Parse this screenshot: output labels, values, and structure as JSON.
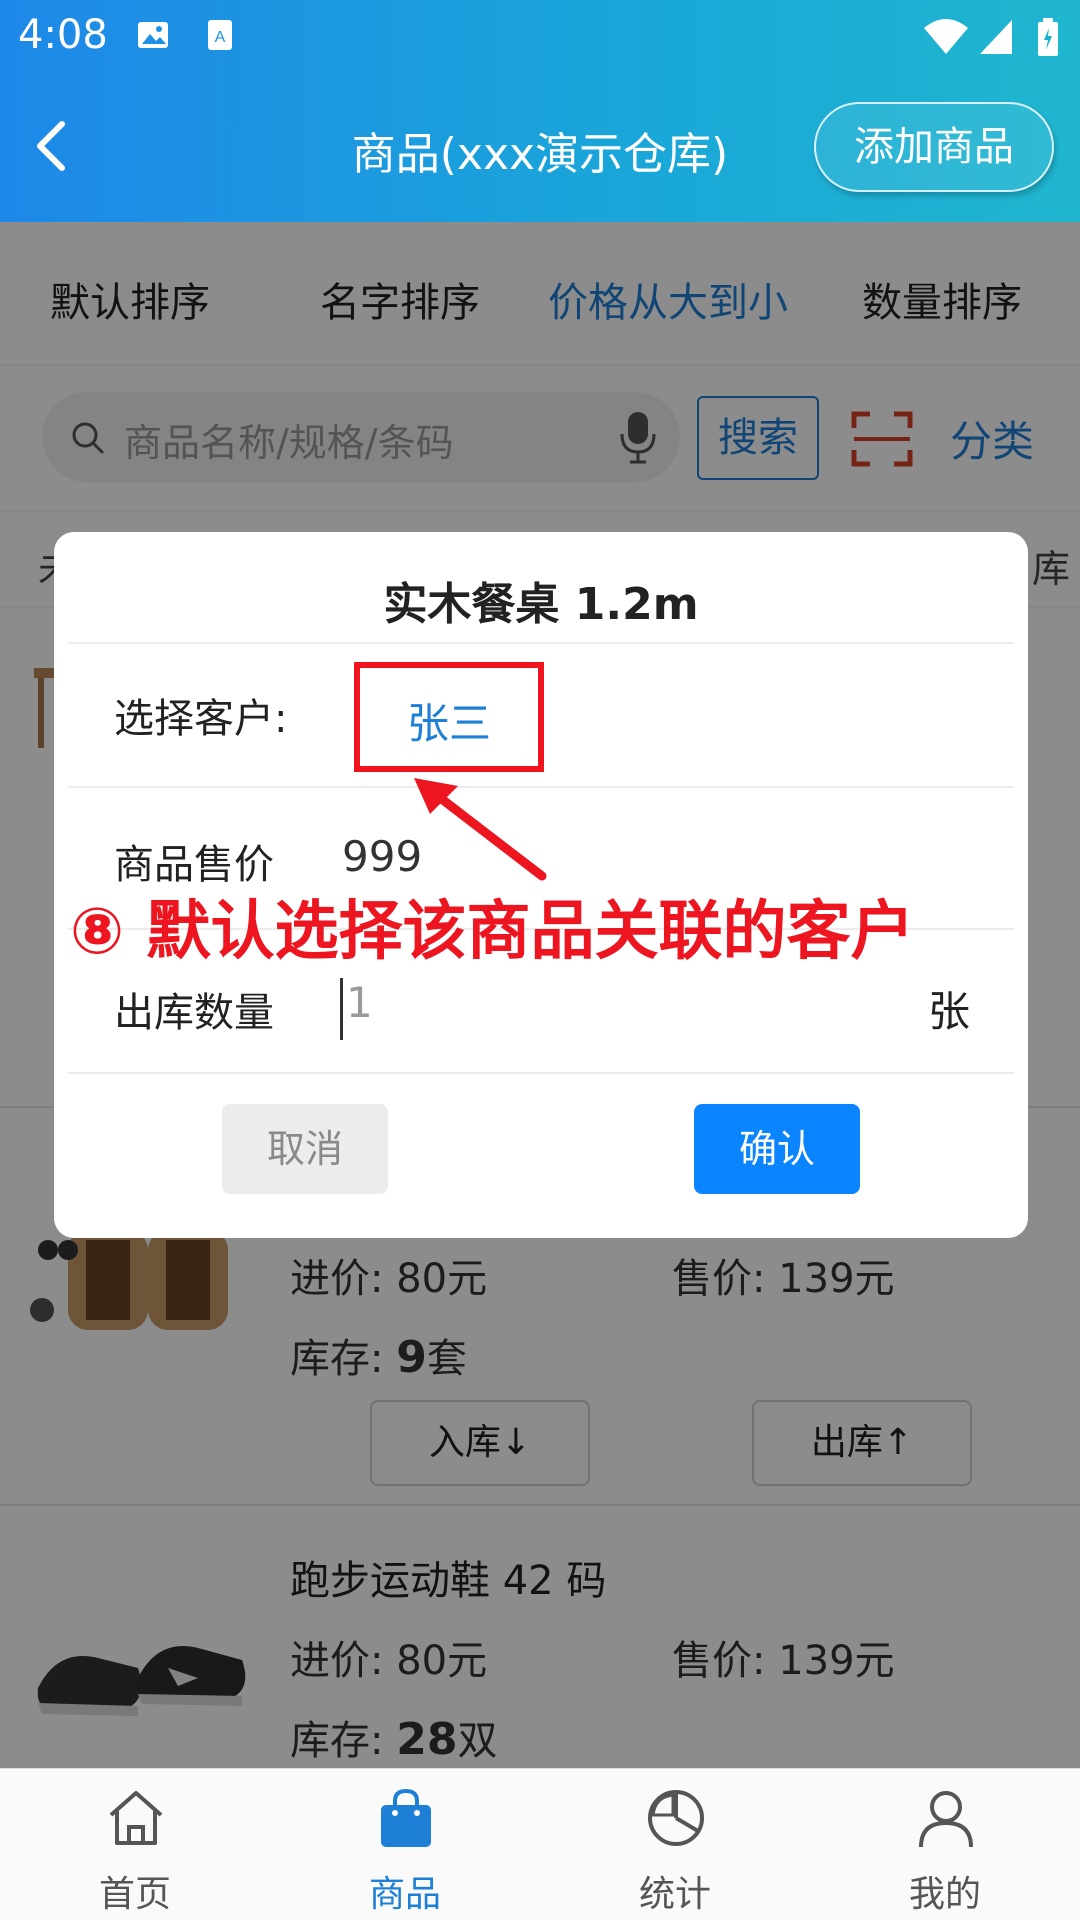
{
  "status_bar": {
    "time": "4:08"
  },
  "header": {
    "title": "商品(xxx演示仓库)",
    "add_button": "添加商品"
  },
  "sort": {
    "items": [
      "默认排序",
      "名字排序",
      "价格从大到小",
      "数量排序"
    ],
    "active_index": 2
  },
  "search": {
    "placeholder": "商品名称/规格/条码",
    "button": "搜索",
    "category": "分类"
  },
  "list_header": {
    "left_edge": "未",
    "right_edge": "库"
  },
  "products": [
    {
      "name": "",
      "purchase_label": "进价:",
      "purchase": "80元",
      "sale_label": "售价:",
      "sale": "139元",
      "stock_label": "库存:",
      "stock_qty": "9",
      "stock_unit": "套",
      "in_button": "入库↓",
      "out_button": "出库↑"
    },
    {
      "name": "跑步运动鞋  42 码",
      "purchase_label": "进价:",
      "purchase": "80元",
      "sale_label": "售价:",
      "sale": "139元",
      "stock_label": "库存:",
      "stock_qty": "28",
      "stock_unit": "双"
    }
  ],
  "dialog": {
    "title": "实木餐桌  1.2m",
    "customer_label": "选择客户:",
    "customer": "张三",
    "price_label": "商品售价",
    "price": "999",
    "qty_label": "出库数量",
    "qty": "1",
    "unit": "张",
    "cancel": "取消",
    "confirm": "确认"
  },
  "annotation": "⑧ 默认选择该商品关联的客户",
  "nav": [
    {
      "label": "首页",
      "icon": "home-icon"
    },
    {
      "label": "商品",
      "icon": "shopping-bag-icon",
      "active": true
    },
    {
      "label": "统计",
      "icon": "pie-chart-icon"
    },
    {
      "label": "我的",
      "icon": "user-icon"
    }
  ],
  "colors": {
    "accent": "#1e7fd6",
    "confirm": "#0a84ff",
    "annotation": "#ec1520"
  }
}
